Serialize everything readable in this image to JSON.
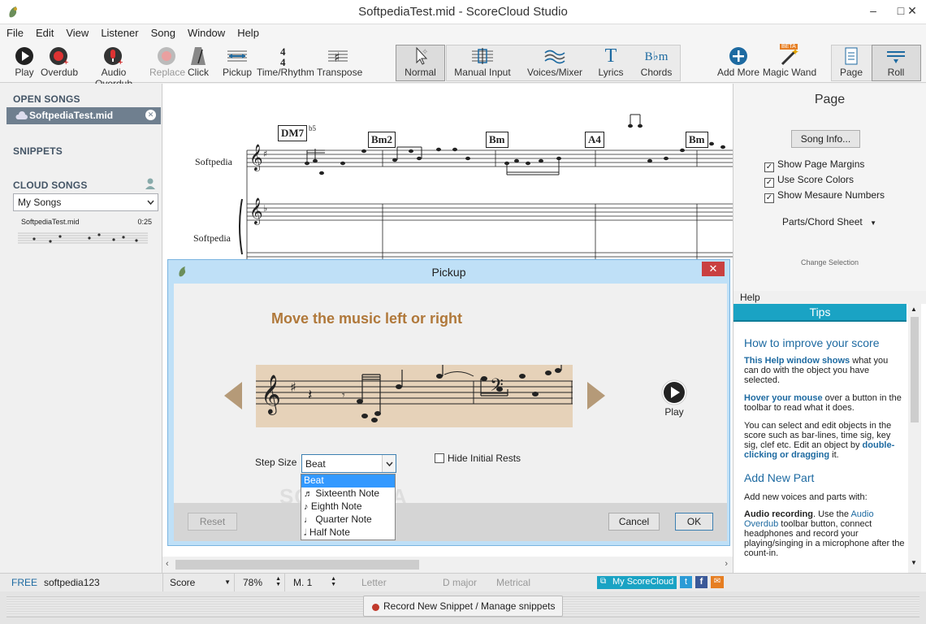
{
  "window": {
    "title": "SoftpediaTest.mid - ScoreCloud Studio",
    "min": "–",
    "max": "□",
    "close": "✕"
  },
  "menu": [
    "File",
    "Edit",
    "View",
    "Listener",
    "Song",
    "Window",
    "Help"
  ],
  "toolbar": {
    "play": "Play",
    "overdub": "Overdub",
    "audio_overdub": "Audio Overdub",
    "replace": "Replace",
    "click": "Click",
    "pickup": "Pickup",
    "time_rhythm": "Time/Rhythm",
    "transpose": "Transpose",
    "normal": "Normal",
    "manual_input": "Manual Input",
    "voices_mixer": "Voices/Mixer",
    "lyrics": "Lyrics",
    "chords": "Chords",
    "chords_glyph": "B♭m",
    "lyrics_glyph": "T",
    "add_more": "Add More",
    "magic_wand": "Magic Wand",
    "magic_wand_badge": "BETA",
    "page": "Page",
    "roll": "Roll"
  },
  "left": {
    "open_songs_title": "OPEN SONGS",
    "open_song": "SoftpediaTest.mid",
    "snippets_title": "SNIPPETS",
    "cloud_title": "CLOUD SONGS",
    "cloud_select": "My Songs",
    "cloud_item_name": "SoftpediaTest.mid",
    "cloud_item_time": "0:25"
  },
  "score": {
    "chords": [
      "DM7",
      "Bm2",
      "Bm",
      "A4",
      "Bm"
    ],
    "chord_ext": "b5",
    "staff_labels": [
      "Softpedia",
      "Softpedia"
    ]
  },
  "right": {
    "title": "Page",
    "song_info": "Song Info...",
    "options": [
      {
        "label": "Show Page Margins",
        "checked": true
      },
      {
        "label": "Use Score Colors",
        "checked": true
      },
      {
        "label": "Show Mesaure Numbers",
        "checked": true
      }
    ],
    "parts_label": "Parts/Chord Sheet",
    "change_selection": "Change Selection"
  },
  "help": {
    "header": "Help",
    "tab": "Tips",
    "heading1": "How to improve your score",
    "p1_bold": "This Help window shows",
    "p1_rest": " what you can do with the object you have selected.",
    "p2_bold": "Hover your mouse",
    "p2_rest": " over a button in the toolbar to read what it does.",
    "p3_a": "You can select and edit objects in the score such as bar-lines, time sig, key sig, clef etc. Edit an object by ",
    "p3_bold": "double-clicking or dragging",
    "p3_b": " it.",
    "heading2": "Add New Part",
    "p4": "Add new voices and parts with:",
    "p5_bold": "Audio recording",
    "p5_a": ". Use the ",
    "p5_link": "Audio Overdub",
    "p5_b": " toolbar button, connect headphones and record your playing/singing in a microphone after the count-in."
  },
  "dialog": {
    "title": "Pickup",
    "heading": "Move the music left or right",
    "play_label": "Play",
    "step_label": "Step Size",
    "step_value": "Beat",
    "hide_rests": "Hide Initial Rests",
    "options": [
      "Beat",
      "Sixteenth Note",
      "Eighth Note",
      "Quarter Note",
      "Half Note"
    ],
    "reset": "Reset",
    "cancel": "Cancel",
    "ok": "OK",
    "close": "✕",
    "watermark": "SOFTPEDIA"
  },
  "status": {
    "tier": "FREE",
    "user": "softpedia123",
    "view": "Score",
    "zoom": "78%",
    "measure": "M. 1",
    "paper": "Letter",
    "key": "D major",
    "units": "Metrical",
    "myscorecloud": "My ScoreCloud"
  },
  "bottom": {
    "record": "Record New Snippet / Manage snippets"
  },
  "colors": {
    "accent": "#1d6aa1",
    "heading_brown": "#b0783a",
    "tips_teal": "#1aa3c4",
    "dialog_blue": "#bfe0f7"
  }
}
